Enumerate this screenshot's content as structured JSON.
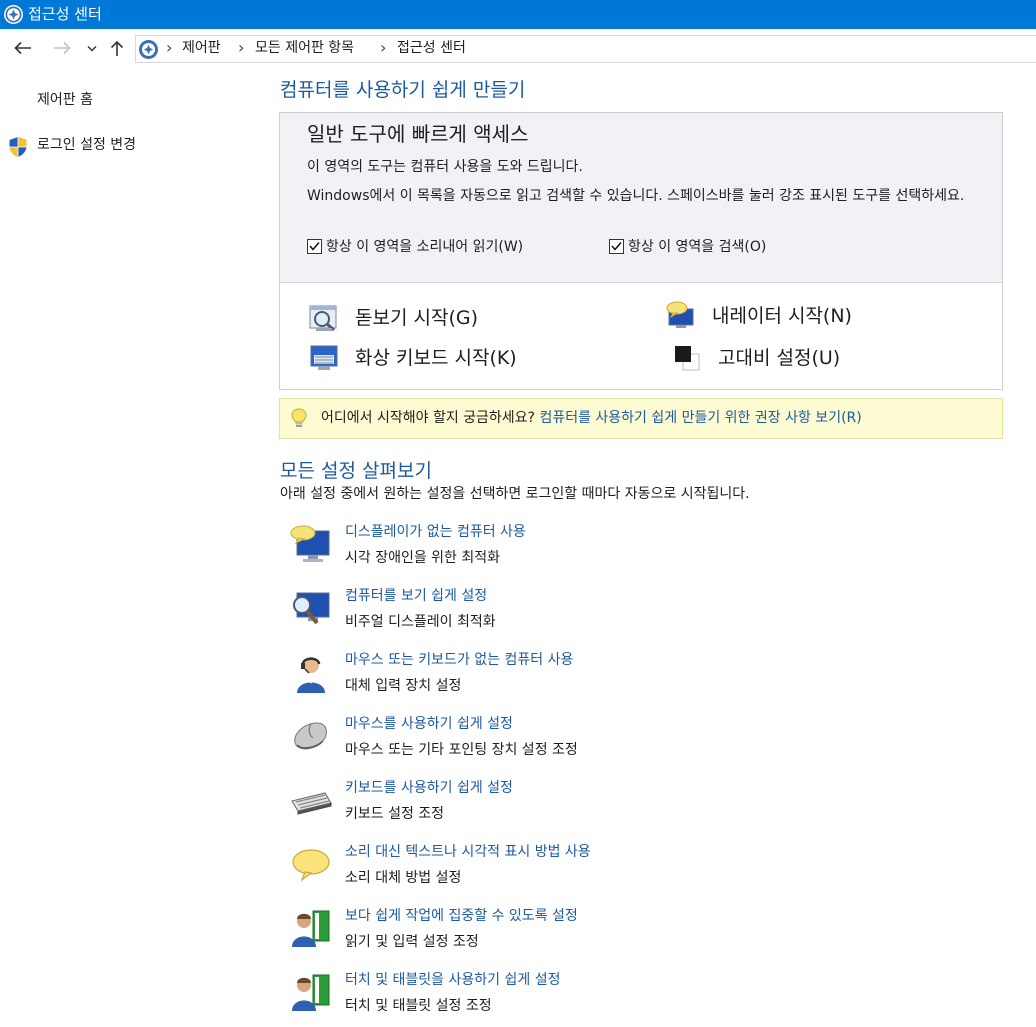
{
  "window": {
    "title": "접근성 센터",
    "titlebar_color": "#0078d7"
  },
  "address_bar": {
    "breadcrumbs": [
      "제어판",
      "모든 제어판 항목",
      "접근성 센터"
    ]
  },
  "sidebar": {
    "items": [
      {
        "label": "제어판 홈"
      },
      {
        "label": "로그인 설정 변경",
        "icon": "uac-shield-icon"
      }
    ]
  },
  "main": {
    "heading": "컴퓨터를 사용하기 쉽게 만들기",
    "quick_access": {
      "title": "일반 도구에 빠르게 액세스",
      "description": "이 영역의 도구는 컴퓨터 사용을 도와 드립니다.",
      "instruction": "Windows에서 이 목록을 자동으로 읽고 검색할 수 있습니다. 스페이스바를 눌러 강조 표시된 도구를 선택하세요.",
      "checkboxes": [
        {
          "label": "항상 이 영역을 소리내어 읽기(W)",
          "checked": true
        },
        {
          "label": "항상 이 영역을 검색(O)",
          "checked": true
        }
      ],
      "tools": [
        {
          "label": "돋보기 시작(G)",
          "icon": "magnifier-icon"
        },
        {
          "label": "내레이터 시작(N)",
          "icon": "narrator-icon"
        },
        {
          "label": "화상 키보드 시작(K)",
          "icon": "on-screen-keyboard-icon"
        },
        {
          "label": "고대비 설정(U)",
          "icon": "high-contrast-icon"
        }
      ]
    },
    "tip": {
      "text": "어디에서 시작해야 할지 궁금하세요?",
      "link": "컴퓨터를 사용하기 쉽게 만들기 위한 권장 사항 보기(R)"
    },
    "explore": {
      "heading": "모든 설정 살펴보기",
      "description": "아래 설정 중에서 원하는 설정을 선택하면 로그인할 때마다 자동으로 시작됩니다.",
      "items": [
        {
          "link": "디스플레이가 없는 컴퓨터 사용",
          "desc": "시각 장애인을 위한 최적화",
          "icon": "monitor-speech-icon"
        },
        {
          "link": "컴퓨터를 보기 쉽게 설정",
          "desc": "비주얼 디스플레이 최적화",
          "icon": "monitor-magnifier-icon"
        },
        {
          "link": "마우스 또는 키보드가 없는 컴퓨터 사용",
          "desc": "대체 입력 장치 설정",
          "icon": "headset-person-icon"
        },
        {
          "link": "마우스를 사용하기 쉽게 설정",
          "desc": "마우스 또는 기타 포인팅 장치 설정 조정",
          "icon": "mouse-icon"
        },
        {
          "link": "키보드를 사용하기 쉽게 설정",
          "desc": "키보드 설정 조정",
          "icon": "keyboard-icon"
        },
        {
          "link": "소리 대신 텍스트나 시각적 표시 방법 사용",
          "desc": "소리 대체 방법 설정",
          "icon": "speech-bubble-icon"
        },
        {
          "link": "보다 쉽게 작업에 집중할 수 있도록 설정",
          "desc": "읽기 및 입력 설정 조정",
          "icon": "person-book-icon"
        },
        {
          "link": "터치 및 태블릿을 사용하기 쉽게 설정",
          "desc": "터치 및 태블릿 설정 조정",
          "icon": "person-tablet-icon"
        }
      ]
    }
  },
  "colors": {
    "link": "#1e5aa0",
    "tip_background": "#fcfbd1",
    "panel_background": "#f1f2f5"
  }
}
